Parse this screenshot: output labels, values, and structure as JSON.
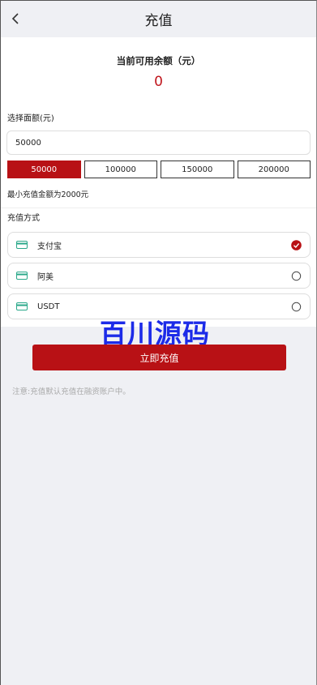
{
  "header": {
    "title": "充值"
  },
  "balance": {
    "label": "当前可用余额（元）",
    "value": "0"
  },
  "amount": {
    "label": "选择面额(元)",
    "input_value": "50000",
    "options": [
      "50000",
      "100000",
      "150000",
      "200000"
    ],
    "selected": "50000",
    "min_note": "最小充值金额为2000元"
  },
  "methods": {
    "title": "充值方式",
    "items": [
      {
        "name": "支付宝",
        "selected": true
      },
      {
        "name": "阿美",
        "selected": false
      },
      {
        "name": "USDT",
        "selected": false
      }
    ]
  },
  "watermark": "百川源码",
  "submit_label": "立即充值",
  "footnote": "注意:充值默认充值在融资账户中。",
  "colors": {
    "accent": "#b81115",
    "watermark": "#1c2be8",
    "background": "#eff0f4"
  }
}
